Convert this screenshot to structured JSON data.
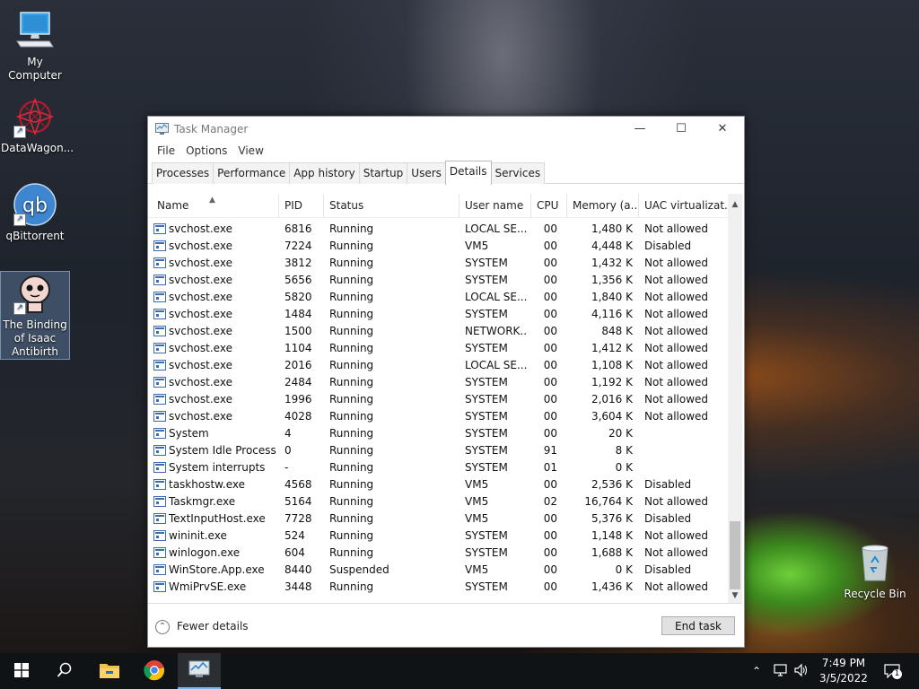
{
  "desktop": {
    "icons": [
      {
        "label": "My Computer"
      },
      {
        "label": "DataWagon..."
      },
      {
        "label": "qBittorrent"
      },
      {
        "label": "The Binding of Isaac Antibirth"
      },
      {
        "label": "Recycle Bin"
      }
    ]
  },
  "window": {
    "title": "Task Manager",
    "menu": [
      "File",
      "Options",
      "View"
    ],
    "tabs": [
      "Processes",
      "Performance",
      "App history",
      "Startup",
      "Users",
      "Details",
      "Services"
    ],
    "active_tab": "Details",
    "columns": [
      "Name",
      "PID",
      "Status",
      "User name",
      "CPU",
      "Memory (a...",
      "UAC virtualizat..."
    ],
    "rows": [
      {
        "name": "svchost.exe",
        "pid": "6816",
        "status": "Running",
        "user": "LOCAL SE...",
        "cpu": "00",
        "mem": "1,480 K",
        "uac": "Not allowed"
      },
      {
        "name": "svchost.exe",
        "pid": "7224",
        "status": "Running",
        "user": "VM5",
        "cpu": "00",
        "mem": "4,448 K",
        "uac": "Disabled"
      },
      {
        "name": "svchost.exe",
        "pid": "3812",
        "status": "Running",
        "user": "SYSTEM",
        "cpu": "00",
        "mem": "1,432 K",
        "uac": "Not allowed"
      },
      {
        "name": "svchost.exe",
        "pid": "5656",
        "status": "Running",
        "user": "SYSTEM",
        "cpu": "00",
        "mem": "1,356 K",
        "uac": "Not allowed"
      },
      {
        "name": "svchost.exe",
        "pid": "5820",
        "status": "Running",
        "user": "LOCAL SE...",
        "cpu": "00",
        "mem": "1,840 K",
        "uac": "Not allowed"
      },
      {
        "name": "svchost.exe",
        "pid": "1484",
        "status": "Running",
        "user": "SYSTEM",
        "cpu": "00",
        "mem": "4,116 K",
        "uac": "Not allowed"
      },
      {
        "name": "svchost.exe",
        "pid": "1500",
        "status": "Running",
        "user": "NETWORK...",
        "cpu": "00",
        "mem": "848 K",
        "uac": "Not allowed"
      },
      {
        "name": "svchost.exe",
        "pid": "1104",
        "status": "Running",
        "user": "SYSTEM",
        "cpu": "00",
        "mem": "1,412 K",
        "uac": "Not allowed"
      },
      {
        "name": "svchost.exe",
        "pid": "2016",
        "status": "Running",
        "user": "LOCAL SE...",
        "cpu": "00",
        "mem": "1,108 K",
        "uac": "Not allowed"
      },
      {
        "name": "svchost.exe",
        "pid": "2484",
        "status": "Running",
        "user": "SYSTEM",
        "cpu": "00",
        "mem": "1,192 K",
        "uac": "Not allowed"
      },
      {
        "name": "svchost.exe",
        "pid": "1996",
        "status": "Running",
        "user": "SYSTEM",
        "cpu": "00",
        "mem": "2,016 K",
        "uac": "Not allowed"
      },
      {
        "name": "svchost.exe",
        "pid": "4028",
        "status": "Running",
        "user": "SYSTEM",
        "cpu": "00",
        "mem": "3,604 K",
        "uac": "Not allowed"
      },
      {
        "name": "System",
        "pid": "4",
        "status": "Running",
        "user": "SYSTEM",
        "cpu": "00",
        "mem": "20 K",
        "uac": ""
      },
      {
        "name": "System Idle Process",
        "pid": "0",
        "status": "Running",
        "user": "SYSTEM",
        "cpu": "91",
        "mem": "8 K",
        "uac": ""
      },
      {
        "name": "System interrupts",
        "pid": "-",
        "status": "Running",
        "user": "SYSTEM",
        "cpu": "01",
        "mem": "0 K",
        "uac": ""
      },
      {
        "name": "taskhostw.exe",
        "pid": "4568",
        "status": "Running",
        "user": "VM5",
        "cpu": "00",
        "mem": "2,536 K",
        "uac": "Disabled"
      },
      {
        "name": "Taskmgr.exe",
        "pid": "5164",
        "status": "Running",
        "user": "VM5",
        "cpu": "02",
        "mem": "16,764 K",
        "uac": "Not allowed"
      },
      {
        "name": "TextInputHost.exe",
        "pid": "7728",
        "status": "Running",
        "user": "VM5",
        "cpu": "00",
        "mem": "5,376 K",
        "uac": "Disabled"
      },
      {
        "name": "wininit.exe",
        "pid": "524",
        "status": "Running",
        "user": "SYSTEM",
        "cpu": "00",
        "mem": "1,148 K",
        "uac": "Not allowed"
      },
      {
        "name": "winlogon.exe",
        "pid": "604",
        "status": "Running",
        "user": "SYSTEM",
        "cpu": "00",
        "mem": "1,688 K",
        "uac": "Not allowed"
      },
      {
        "name": "WinStore.App.exe",
        "pid": "8440",
        "status": "Suspended",
        "user": "VM5",
        "cpu": "00",
        "mem": "0 K",
        "uac": "Disabled"
      },
      {
        "name": "WmiPrvSE.exe",
        "pid": "3448",
        "status": "Running",
        "user": "SYSTEM",
        "cpu": "00",
        "mem": "1,436 K",
        "uac": "Not allowed"
      }
    ],
    "fewer_details_label": "Fewer details",
    "end_task_label": "End task"
  },
  "taskbar": {
    "time": "7:49 PM",
    "date": "3/5/2022",
    "notification_count": "1"
  },
  "colors": {
    "accent": "#7fb2e5",
    "window_bg": "#ffffff",
    "taskbar_bg": "#101316"
  }
}
